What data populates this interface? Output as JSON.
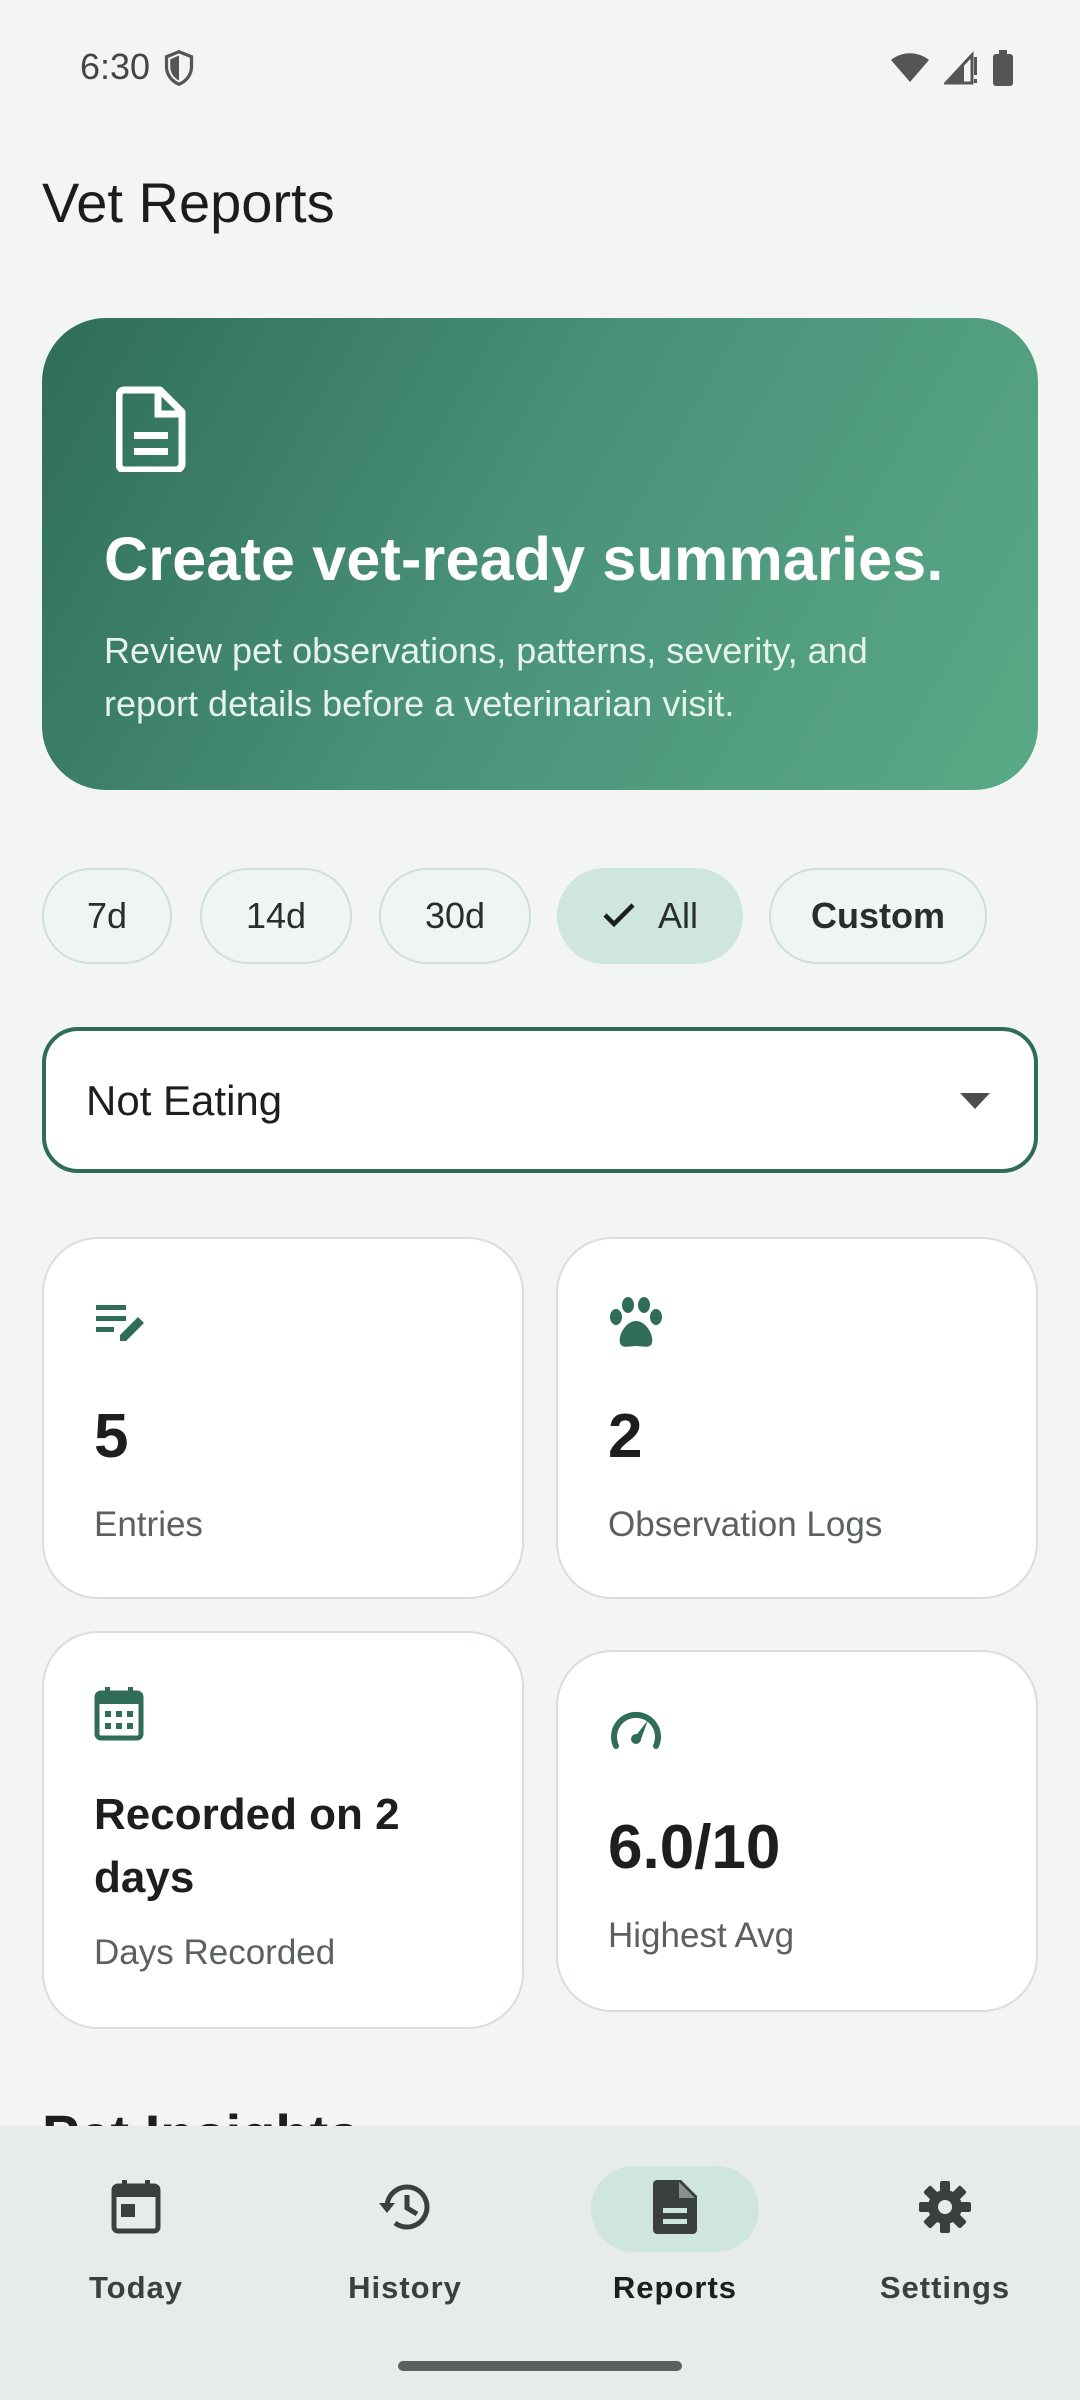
{
  "status_bar": {
    "time": "6:30"
  },
  "page_title": "Vet Reports",
  "hero": {
    "icon": "document-icon",
    "title": "Create vet-ready summaries.",
    "subtitle": "Review pet observations, patterns, severity, and report details before a veterinarian visit."
  },
  "filters": {
    "chips": [
      {
        "label": "7d",
        "selected": false
      },
      {
        "label": "14d",
        "selected": false
      },
      {
        "label": "30d",
        "selected": false
      },
      {
        "label": "All",
        "selected": true
      },
      {
        "label": "Custom",
        "selected": false
      }
    ]
  },
  "symptom_select": {
    "value": "Not Eating"
  },
  "stats": {
    "entries": {
      "icon": "edit-notes-icon",
      "value": "5",
      "label": "Entries"
    },
    "observation_logs": {
      "icon": "paw-icon",
      "value": "2",
      "label": "Observation Logs"
    },
    "days_recorded": {
      "icon": "calendar-icon",
      "value": "Recorded on 2 days",
      "label": "Days Recorded"
    },
    "highest_avg": {
      "icon": "speedometer-icon",
      "value": "6.0/10",
      "label": "Highest Avg"
    }
  },
  "next_section_peek": "Pet Insights",
  "bottom_nav": {
    "items": [
      {
        "label": "Today",
        "icon": "calendar-icon",
        "active": false
      },
      {
        "label": "History",
        "icon": "history-icon",
        "active": false
      },
      {
        "label": "Reports",
        "icon": "document-icon",
        "active": true
      },
      {
        "label": "Settings",
        "icon": "gear-icon",
        "active": false
      }
    ]
  },
  "colors": {
    "accent": "#2f6d57",
    "selected_bg": "#cfe6dc",
    "background": "#f3f5f3"
  }
}
